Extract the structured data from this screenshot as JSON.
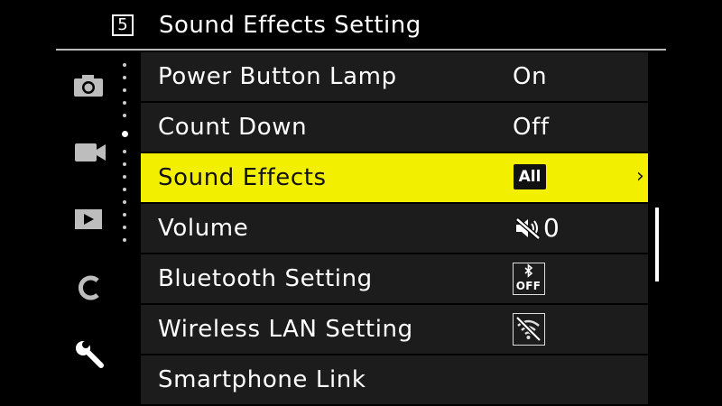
{
  "header": {
    "page_number": "5",
    "title": "Sound Effects Setting"
  },
  "sidebar": {
    "icons": [
      "camera-icon",
      "video-camera-icon",
      "play-icon",
      "custom-c-icon",
      "wrench-icon"
    ]
  },
  "menu": {
    "items": [
      {
        "label": "Power Button Lamp",
        "value": "On"
      },
      {
        "label": "Count Down",
        "value": "Off"
      },
      {
        "label": "Sound Effects",
        "value": "All",
        "selected": true
      },
      {
        "label": "Volume",
        "value": "0",
        "value_icon": "speaker-muted-icon"
      },
      {
        "label": "Bluetooth Setting",
        "value": "OFF",
        "value_icon": "bluetooth-icon"
      },
      {
        "label": "Wireless LAN Setting",
        "value_icon": "wifi-off-icon"
      },
      {
        "label": "Smartphone Link"
      }
    ]
  },
  "colors": {
    "selected_bg": "#f3ef00",
    "row_bg": "#1c1c1c",
    "background": "#000000"
  }
}
